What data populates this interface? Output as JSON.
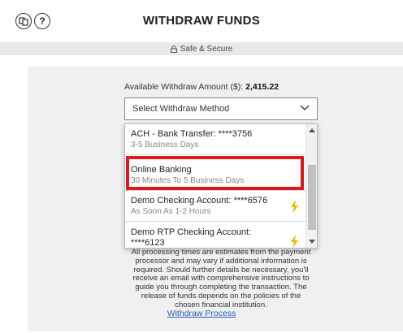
{
  "header": {
    "title": "WITHDRAW FUNDS",
    "left_icons": [
      "transfer-icon",
      "help-icon"
    ],
    "help_glyph": "?"
  },
  "secure_bar": {
    "label": "Safe & Secure",
    "icon": "lock-icon"
  },
  "available": {
    "label": "Available Withdraw Amount ($):",
    "amount": "2,415.22"
  },
  "method_select": {
    "placeholder": "Select Withdraw Method",
    "options": [
      {
        "name": "ACH - Bank Transfer: ****3756",
        "eta": "3-5 Business Days",
        "instant": false
      },
      {
        "name": "Online Banking",
        "eta": "30 Minutes To 5 Business Days",
        "instant": false,
        "highlighted": true
      },
      {
        "name": "Demo Checking Account: ****6576",
        "eta": "As Soon As 1-2 Hours",
        "instant": true
      },
      {
        "name": "Demo RTP Checking Account: ****6123",
        "eta": "",
        "instant": true
      }
    ]
  },
  "disclaimer": "All processing times are estimates from the payment processor and may vary if additional information is required. Should further details be necessary, you'll receive an email with comprehensive instructions to guide you through completing the transaction. The release of funds depends on the policies of the chosen financial institution.",
  "withdraw_process_link": "Withdraw Process",
  "colors": {
    "highlight_border": "#e0181e",
    "bolt": "#f2b705",
    "link": "#2a5db0",
    "panel_bg": "#f0f0f0"
  }
}
